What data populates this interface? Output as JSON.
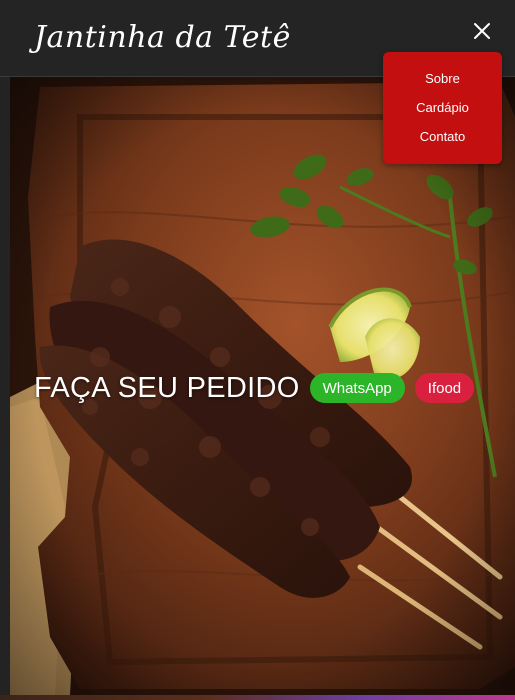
{
  "header": {
    "brand": "Jantinha da Tetê",
    "close_icon": "close-icon"
  },
  "nav": {
    "items": [
      {
        "label": "Sobre"
      },
      {
        "label": "Cardápio"
      },
      {
        "label": "Contato"
      }
    ]
  },
  "hero": {
    "cta_text": "FAÇA SEU PEDIDO",
    "buttons": {
      "whatsapp": "WhatsApp",
      "ifood": "Ifood"
    }
  },
  "colors": {
    "menu_bg": "#c30f0f",
    "whatsapp": "#2db52a",
    "ifood": "#d9213f",
    "topbar": "#242424"
  }
}
